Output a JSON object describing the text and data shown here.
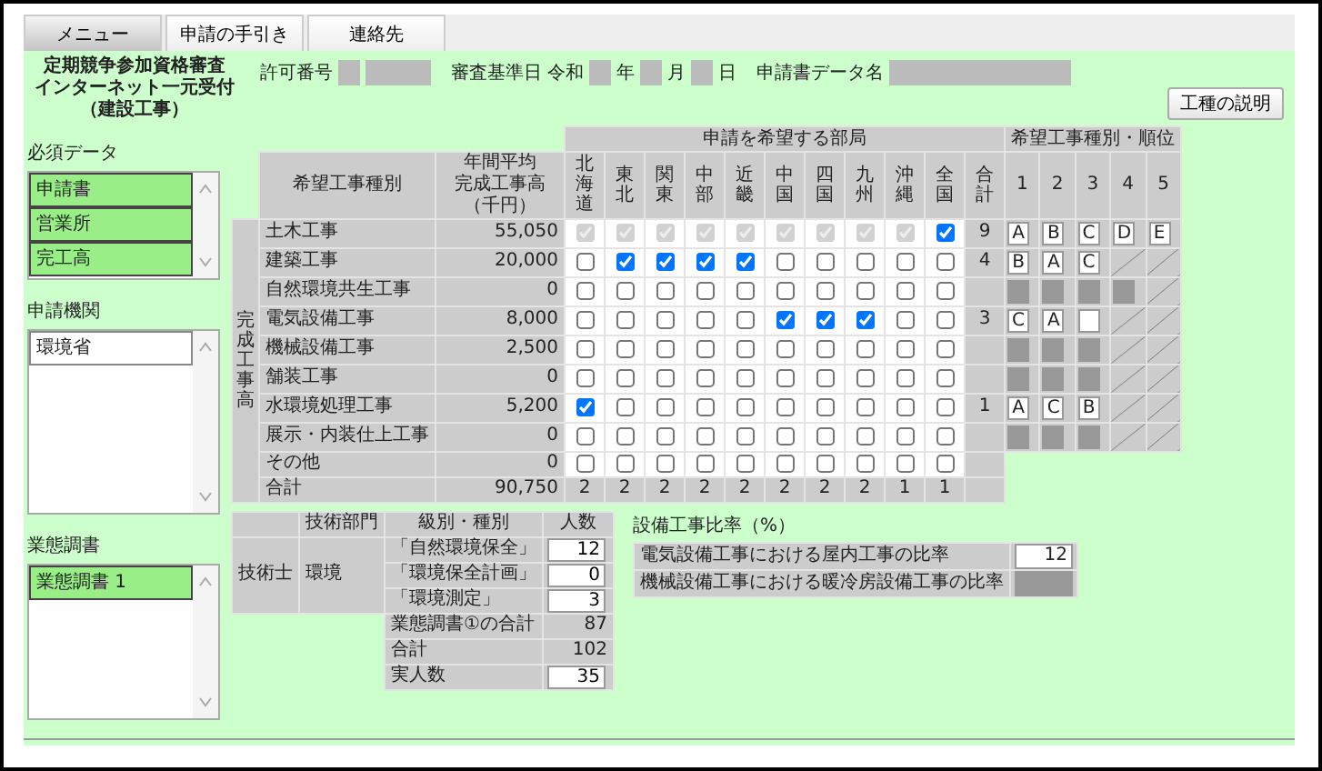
{
  "tabs": [
    {
      "label": "メニュー",
      "selected": true
    },
    {
      "label": "申請の手引き",
      "selected": false
    },
    {
      "label": "連絡先",
      "selected": false
    }
  ],
  "header": {
    "title_lines": [
      "定期競争参加資格審査",
      "インターネット一元受付",
      "（建設工事）"
    ],
    "permit_label": "許可番号",
    "date_label": "審査基準日",
    "era": "令和",
    "year_unit": "年",
    "month_unit": "月",
    "day_unit": "日",
    "data_name_label": "申請書データ名"
  },
  "explain_button": "工種の説明",
  "lists": [
    {
      "title": "必須データ",
      "items": [
        {
          "label": "申請書",
          "selected": true
        },
        {
          "label": "営業所",
          "selected": true
        },
        {
          "label": "完工高",
          "selected": true
        }
      ]
    },
    {
      "title": "申請機関",
      "items": [
        {
          "label": "環境省",
          "selected": false
        }
      ]
    },
    {
      "title": "業態調書",
      "items": [
        {
          "label": "業態調書 1",
          "selected": true
        }
      ]
    }
  ],
  "works_table": {
    "side_label": "完成工事高",
    "type_header": "希望工事種別",
    "amount_header": [
      "年間平均",
      "完成工事高",
      "（千円）"
    ],
    "departments_header": "申請を希望する部局",
    "departments": [
      "北海道",
      "東北",
      "関東",
      "中部",
      "近畿",
      "中国",
      "四国",
      "九州",
      "沖縄",
      "全国"
    ],
    "total_header": "合計",
    "rank_header": "希望工事種別・順位",
    "rank_numbers": [
      "1",
      "2",
      "3",
      "4",
      "5"
    ],
    "rows": [
      {
        "type": "土木工事",
        "amount": "55,050",
        "checks": [
          {
            "checked": true,
            "disabled": true
          },
          {
            "checked": true,
            "disabled": true
          },
          {
            "checked": true,
            "disabled": true
          },
          {
            "checked": true,
            "disabled": true
          },
          {
            "checked": true,
            "disabled": true
          },
          {
            "checked": true,
            "disabled": true
          },
          {
            "checked": true,
            "disabled": true
          },
          {
            "checked": true,
            "disabled": true
          },
          {
            "checked": true,
            "disabled": true
          },
          {
            "checked": true,
            "disabled": false
          }
        ],
        "total": "9",
        "ranks": [
          {
            "kind": "letter",
            "text": "A"
          },
          {
            "kind": "letter",
            "text": "B"
          },
          {
            "kind": "letter",
            "text": "C"
          },
          {
            "kind": "letter",
            "text": "D"
          },
          {
            "kind": "letter",
            "text": "E"
          }
        ]
      },
      {
        "type": "建築工事",
        "amount": "20,000",
        "checks": [
          {
            "checked": false,
            "disabled": false
          },
          {
            "checked": true,
            "disabled": false
          },
          {
            "checked": true,
            "disabled": false
          },
          {
            "checked": true,
            "disabled": false
          },
          {
            "checked": true,
            "disabled": false
          },
          {
            "checked": false,
            "disabled": false
          },
          {
            "checked": false,
            "disabled": false
          },
          {
            "checked": false,
            "disabled": false
          },
          {
            "checked": false,
            "disabled": false
          },
          {
            "checked": false,
            "disabled": false
          }
        ],
        "total": "4",
        "ranks": [
          {
            "kind": "letter",
            "text": "B"
          },
          {
            "kind": "letter",
            "text": "A"
          },
          {
            "kind": "letter",
            "text": "C"
          },
          {
            "kind": "none"
          },
          {
            "kind": "none"
          }
        ]
      },
      {
        "type": "自然環境共生工事",
        "amount": "0",
        "checks": [
          {
            "checked": false,
            "disabled": false
          },
          {
            "checked": false,
            "disabled": false
          },
          {
            "checked": false,
            "disabled": false
          },
          {
            "checked": false,
            "disabled": false
          },
          {
            "checked": false,
            "disabled": false
          },
          {
            "checked": false,
            "disabled": false
          },
          {
            "checked": false,
            "disabled": false
          },
          {
            "checked": false,
            "disabled": false
          },
          {
            "checked": false,
            "disabled": false
          },
          {
            "checked": false,
            "disabled": false
          }
        ],
        "ranks": [
          {
            "kind": "unavailable"
          },
          {
            "kind": "unavailable"
          },
          {
            "kind": "unavailable"
          },
          {
            "kind": "unavailable"
          },
          {
            "kind": "none"
          }
        ]
      },
      {
        "type": "電気設備工事",
        "amount": "8,000",
        "checks": [
          {
            "checked": false,
            "disabled": false
          },
          {
            "checked": false,
            "disabled": false
          },
          {
            "checked": false,
            "disabled": false
          },
          {
            "checked": false,
            "disabled": false
          },
          {
            "checked": false,
            "disabled": false
          },
          {
            "checked": true,
            "disabled": false
          },
          {
            "checked": true,
            "disabled": false
          },
          {
            "checked": true,
            "disabled": false
          },
          {
            "checked": false,
            "disabled": false
          },
          {
            "checked": false,
            "disabled": false
          }
        ],
        "total": "3",
        "ranks": [
          {
            "kind": "letter",
            "text": "C"
          },
          {
            "kind": "letter",
            "text": "A"
          },
          {
            "kind": "blank"
          },
          {
            "kind": "none"
          },
          {
            "kind": "none"
          }
        ]
      },
      {
        "type": "機械設備工事",
        "amount": "2,500",
        "checks": [
          {
            "checked": false,
            "disabled": false
          },
          {
            "checked": false,
            "disabled": false
          },
          {
            "checked": false,
            "disabled": false
          },
          {
            "checked": false,
            "disabled": false
          },
          {
            "checked": false,
            "disabled": false
          },
          {
            "checked": false,
            "disabled": false
          },
          {
            "checked": false,
            "disabled": false
          },
          {
            "checked": false,
            "disabled": false
          },
          {
            "checked": false,
            "disabled": false
          },
          {
            "checked": false,
            "disabled": false
          }
        ],
        "ranks": [
          {
            "kind": "unavailable"
          },
          {
            "kind": "unavailable"
          },
          {
            "kind": "unavailable"
          },
          {
            "kind": "none"
          },
          {
            "kind": "none"
          }
        ]
      },
      {
        "type": "舗装工事",
        "amount": "0",
        "checks": [
          {
            "checked": false,
            "disabled": false
          },
          {
            "checked": false,
            "disabled": false
          },
          {
            "checked": false,
            "disabled": false
          },
          {
            "checked": false,
            "disabled": false
          },
          {
            "checked": false,
            "disabled": false
          },
          {
            "checked": false,
            "disabled": false
          },
          {
            "checked": false,
            "disabled": false
          },
          {
            "checked": false,
            "disabled": false
          },
          {
            "checked": false,
            "disabled": false
          },
          {
            "checked": false,
            "disabled": false
          }
        ],
        "ranks": [
          {
            "kind": "unavailable"
          },
          {
            "kind": "unavailable"
          },
          {
            "kind": "unavailable"
          },
          {
            "kind": "none"
          },
          {
            "kind": "none"
          }
        ]
      },
      {
        "type": "水環境処理工事",
        "amount": "5,200",
        "checks": [
          {
            "checked": true,
            "disabled": false
          },
          {
            "checked": false,
            "disabled": false
          },
          {
            "checked": false,
            "disabled": false
          },
          {
            "checked": false,
            "disabled": false
          },
          {
            "checked": false,
            "disabled": false
          },
          {
            "checked": false,
            "disabled": false
          },
          {
            "checked": false,
            "disabled": false
          },
          {
            "checked": false,
            "disabled": false
          },
          {
            "checked": false,
            "disabled": false
          },
          {
            "checked": false,
            "disabled": false
          }
        ],
        "total": "1",
        "ranks": [
          {
            "kind": "letter",
            "text": "A"
          },
          {
            "kind": "letter",
            "text": "C"
          },
          {
            "kind": "letter",
            "text": "B"
          },
          {
            "kind": "none"
          },
          {
            "kind": "none"
          }
        ]
      },
      {
        "type": "展示・内装仕上工事",
        "amount": "0",
        "checks": [
          {
            "checked": false,
            "disabled": false
          },
          {
            "checked": false,
            "disabled": false
          },
          {
            "checked": false,
            "disabled": false
          },
          {
            "checked": false,
            "disabled": false
          },
          {
            "checked": false,
            "disabled": false
          },
          {
            "checked": false,
            "disabled": false
          },
          {
            "checked": false,
            "disabled": false
          },
          {
            "checked": false,
            "disabled": false
          },
          {
            "checked": false,
            "disabled": false
          },
          {
            "checked": false,
            "disabled": false
          }
        ],
        "ranks": [
          {
            "kind": "unavailable"
          },
          {
            "kind": "unavailable"
          },
          {
            "kind": "unavailable"
          },
          {
            "kind": "none"
          },
          {
            "kind": "none"
          }
        ]
      },
      {
        "type": "その他",
        "amount": "0",
        "checks": [
          {
            "checked": false,
            "disabled": false
          },
          {
            "checked": false,
            "disabled": false
          },
          {
            "checked": false,
            "disabled": false
          },
          {
            "checked": false,
            "disabled": false
          },
          {
            "checked": false,
            "disabled": false
          },
          {
            "checked": false,
            "disabled": false
          },
          {
            "checked": false,
            "disabled": false
          },
          {
            "checked": false,
            "disabled": false
          },
          {
            "checked": false,
            "disabled": false
          },
          {
            "checked": false,
            "disabled": false
          }
        ]
      }
    ],
    "total_row": {
      "label": "合計",
      "amount": "90,750",
      "counts": [
        "2",
        "2",
        "2",
        "2",
        "2",
        "2",
        "2",
        "2",
        "1",
        "1"
      ]
    }
  },
  "engineers": {
    "headers": [
      "技術部門",
      "級別・種別",
      "人数"
    ],
    "qualification": "技術士",
    "department": "環境",
    "rows": [
      {
        "grade": "「自然環境保全」",
        "count": "12"
      },
      {
        "grade": "「環境保全計画」",
        "count": "0"
      },
      {
        "grade": "「環境測定」",
        "count": "3"
      }
    ],
    "summary": [
      {
        "label": "業態調書①の合計",
        "value": "87",
        "kind": "text"
      },
      {
        "label": "合計",
        "value": "102",
        "kind": "text"
      },
      {
        "label": "実人数",
        "value": "35",
        "kind": "input"
      }
    ]
  },
  "ratio": {
    "title": "設備工事比率（%）",
    "rows": [
      {
        "label": "電気設備工事における屋内工事の比率",
        "value": "12",
        "disabled": false
      },
      {
        "label": "機械設備工事における暖冷房設備工事の比率",
        "disabled": true
      }
    ]
  }
}
